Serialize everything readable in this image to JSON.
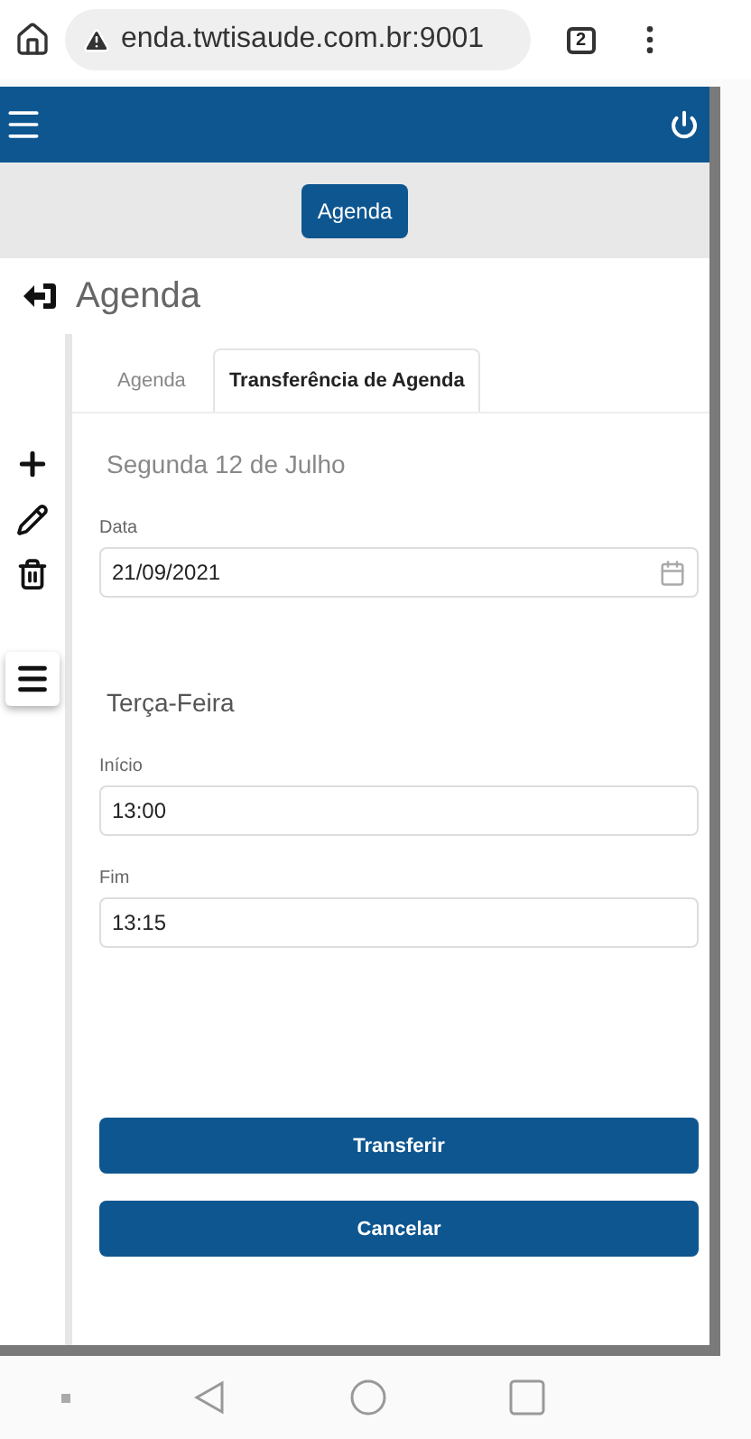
{
  "browser": {
    "url": "enda.twtisaude.com.br:9001",
    "tab_count": "2"
  },
  "nav_button": "Agenda",
  "page_title": "Agenda",
  "tabs": [
    {
      "label": "Agenda",
      "selected": false
    },
    {
      "label": "Transferência de Agenda",
      "selected": true
    }
  ],
  "sections": [
    {
      "heading": "Segunda 12 de Julho",
      "kind": "muted",
      "fields": [
        {
          "label": "Data",
          "value": "21/09/2021",
          "kind": "date"
        }
      ]
    },
    {
      "heading": "Terça-Feira",
      "kind": "dark",
      "fields": [
        {
          "label": "Início",
          "value": "13:00",
          "kind": "text"
        },
        {
          "label": "Fim",
          "value": "13:15",
          "kind": "text"
        }
      ]
    }
  ],
  "buttons": [
    "Transferir",
    "Cancelar"
  ]
}
